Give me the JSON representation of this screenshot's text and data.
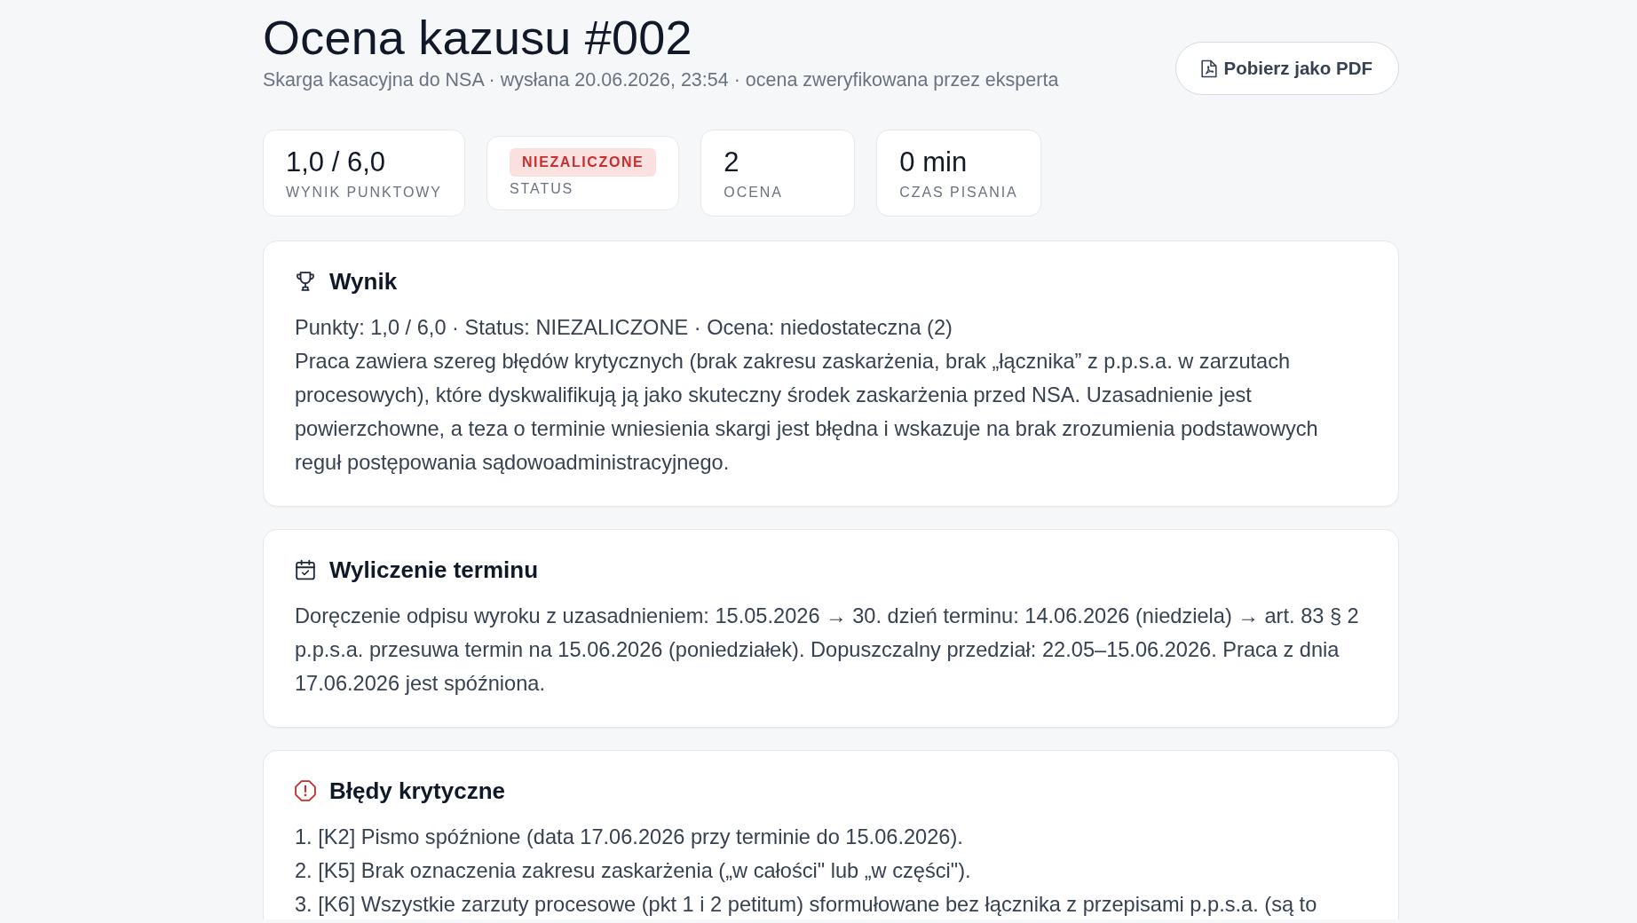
{
  "page": {
    "title": "Ocena kazusu #002",
    "subtitle": "Skarga kasacyjna do NSA · wysłana 20.06.2026, 23:54 · ocena zweryfikowana przez eksperta",
    "pdf_button": "Pobierz jako PDF"
  },
  "stats": [
    {
      "kind": "value",
      "value": "1,0 / 6,0",
      "label": "WYNIK PUNKTOWY"
    },
    {
      "kind": "badge",
      "value": "NIEZALICZONE",
      "passed": false,
      "label": "STATUS"
    },
    {
      "kind": "value",
      "value": "2",
      "label": "OCENA"
    },
    {
      "kind": "value",
      "value": "0 min",
      "label": "CZAS PISANIA"
    }
  ],
  "sections": [
    {
      "kind": "result",
      "title": "Wynik",
      "paragraphs": [
        "Punkty: 1,0 / 6,0 · Status: NIEZALICZONE · Ocena: niedostateczna (2)",
        "Praca zawiera szereg błędów krytycznych (brak zakresu zaskarżenia, brak „łącznika” z p.p.s.a. w zarzutach procesowych), które dyskwalifikują ją jako skuteczny środek zaskarżenia przed NSA. Uzasadnienie jest powierzchowne, a teza o terminie wniesienia skargi jest błędna i wskazuje na brak zrozumienia podstawowych reguł postępowania sądowoadministracyjnego."
      ]
    },
    {
      "kind": "deadline",
      "title": "Wyliczenie terminu",
      "paragraphs": [
        "Doręczenie odpisu wyroku z uzasadnieniem: 15.05.2026 → 30. dzień terminu: 14.06.2026 (niedziela) → art. 83 § 2 p.p.s.a. przesuwa termin na 15.06.2026 (poniedziałek). Dopuszczalny przedział: 22.05–15.06.2026. Praca z dnia 17.06.2026 jest spóźniona."
      ]
    },
    {
      "kind": "errors",
      "title": "Błędy krytyczne",
      "items": [
        "1. [K2] Pismo spóźnione (data 17.06.2026 przy terminie do 15.06.2026).",
        "2. [K5] Brak oznaczenia zakresu zaskarżenia („w całości\" lub „w części\").",
        "3. [K6] Wszystkie zarzuty procesowe (pkt 1 i 2 petitum) sformułowane bez łącznika z przepisami p.p.s.a. (są to"
      ]
    }
  ]
}
